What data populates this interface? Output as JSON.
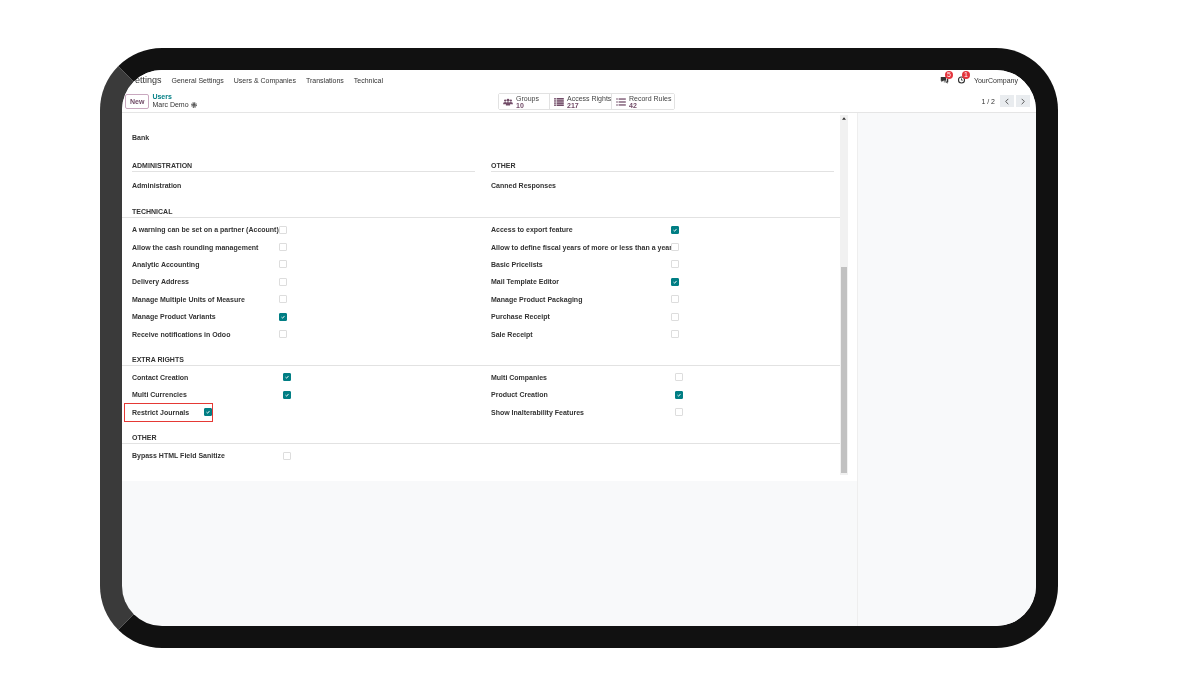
{
  "navbar": {
    "app_title": "ettings",
    "menu": [
      "General Settings",
      "Users & Companies",
      "Translations",
      "Technical"
    ],
    "messages_badge": "5",
    "activities_badge": "1",
    "company": "YourCompany"
  },
  "control_bar": {
    "new_button": "New",
    "breadcrumb": "Users",
    "record": "Marc Demo",
    "smart_buttons": [
      {
        "kind": "groups",
        "label": "Groups",
        "count": "10"
      },
      {
        "kind": "list",
        "label": "Access Rights",
        "count": "217"
      },
      {
        "kind": "rules",
        "label": "Record Rules",
        "count": "42"
      }
    ],
    "pager": "1 / 2"
  },
  "blocks": [
    {
      "kind": "plain",
      "columns": [
        {
          "items": [
            "Bank"
          ]
        }
      ]
    },
    {
      "kind": "plain",
      "columns": [
        {
          "title": "ADMINISTRATION",
          "items": [
            "Administration"
          ]
        },
        {
          "title": "OTHER",
          "items": [
            "Canned Responses"
          ]
        }
      ]
    },
    {
      "kind": "checks",
      "title": "TECHNICAL",
      "columns": [
        [
          {
            "label": "A warning can be set on a partner (Account)",
            "checked": false,
            "highlighted": false
          },
          {
            "label": "Allow the cash rounding management",
            "checked": false,
            "highlighted": false
          },
          {
            "label": "Analytic Accounting",
            "checked": false,
            "highlighted": false
          },
          {
            "label": "Delivery Address",
            "checked": false,
            "highlighted": false
          },
          {
            "label": "Manage Multiple Units of Measure",
            "checked": false,
            "highlighted": false
          },
          {
            "label": "Manage Product Variants",
            "checked": true,
            "highlighted": false
          },
          {
            "label": "Receive notifications in Odoo",
            "checked": false,
            "highlighted": false
          }
        ],
        [
          {
            "label": "Access to export feature",
            "checked": true,
            "highlighted": false
          },
          {
            "label": "Allow to define fiscal years of more or less than a year",
            "checked": false,
            "highlighted": false
          },
          {
            "label": "Basic Pricelists",
            "checked": false,
            "highlighted": false
          },
          {
            "label": "Mail Template Editor",
            "checked": true,
            "highlighted": false
          },
          {
            "label": "Manage Product Packaging",
            "checked": false,
            "highlighted": false
          },
          {
            "label": "Purchase Receipt",
            "checked": false,
            "highlighted": false
          },
          {
            "label": "Sale Receipt",
            "checked": false,
            "highlighted": false
          }
        ]
      ]
    },
    {
      "kind": "checks_compact",
      "title": "EXTRA RIGHTS",
      "columns": [
        [
          {
            "label": "Contact Creation",
            "checked": true,
            "highlighted": false
          },
          {
            "label": "Multi Currencies",
            "checked": true,
            "highlighted": false
          },
          {
            "label": "Restrict Journals",
            "checked": true,
            "highlighted": true
          }
        ],
        [
          {
            "label": "Multi Companies",
            "checked": false,
            "highlighted": false
          },
          {
            "label": "Product Creation",
            "checked": true,
            "highlighted": false
          },
          {
            "label": "Show Inalterability Features",
            "checked": false,
            "highlighted": false
          }
        ]
      ]
    },
    {
      "kind": "checks_compact",
      "title": "OTHER",
      "columns": [
        [
          {
            "label": "Bypass HTML Field Sanitize",
            "checked": false,
            "highlighted": false
          }
        ]
      ]
    }
  ]
}
